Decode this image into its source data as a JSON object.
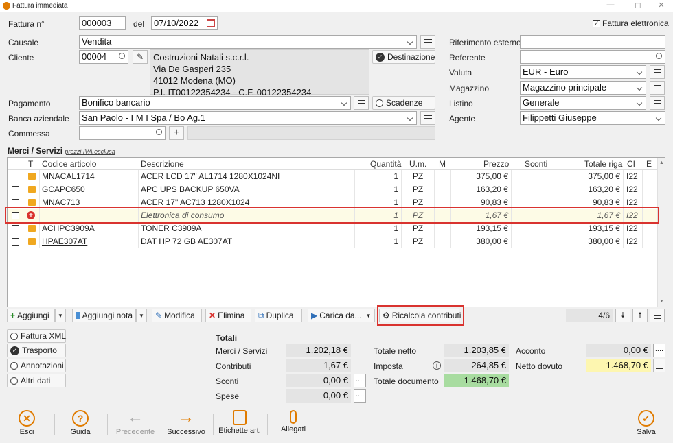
{
  "window": {
    "title": "Fattura immediata"
  },
  "header": {
    "numero_label": "Fattura n°",
    "numero": "000003",
    "del_label": "del",
    "data": "07/10/2022",
    "fattura_elettronica_label": "Fattura elettronica",
    "causale_label": "Causale",
    "causale": "Vendita",
    "cliente_label": "Cliente",
    "cliente_code": "00004",
    "address": [
      "Costruzioni Natali s.c.r.l.",
      "Via De Gasperi 235",
      "41012 Modena (MO)",
      "P.I. IT00122354234 - C.F. 00122354234"
    ],
    "destinazione_label": "Destinazione",
    "pagamento_label": "Pagamento",
    "pagamento": "Bonifico bancario",
    "scadenze_label": "Scadenze",
    "banca_label": "Banca aziendale",
    "banca": "San Paolo - I M I Spa / Bo Ag.1",
    "commessa_label": "Commessa",
    "commessa": "",
    "rif_esterno_label": "Riferimento esterno",
    "rif_esterno": "",
    "referente_label": "Referente",
    "referente": "",
    "valuta_label": "Valuta",
    "valuta": "EUR - Euro",
    "magazzino_label": "Magazzino",
    "magazzino": "Magazzino principale",
    "listino_label": "Listino",
    "listino": "Generale",
    "agente_label": "Agente",
    "agente": "Filippetti Giuseppe"
  },
  "items": {
    "title": "Merci / Servizi",
    "note": "prezzi IVA esclusa",
    "columns": {
      "t": "T",
      "codice": "Codice articolo",
      "descr": "Descrizione",
      "qta": "Quantità",
      "um": "U.m.",
      "m": "M",
      "prezzo": "Prezzo",
      "sconti": "Sconti",
      "totale": "Totale riga",
      "ci": "CI",
      "e": "E"
    },
    "rows": [
      {
        "codice": "MNACAL1714",
        "descr": "ACER LCD 17\" AL1714 1280X1024NI",
        "qta": "1",
        "um": "PZ",
        "prezzo": "375,00 €",
        "totale": "375,00 €",
        "ci": "I22"
      },
      {
        "codice": "GCAPC650",
        "descr": "APC UPS BACKUP 650VA",
        "qta": "1",
        "um": "PZ",
        "prezzo": "163,20 €",
        "totale": "163,20 €",
        "ci": "I22"
      },
      {
        "codice": "MNAC713",
        "descr": "ACER 17\" AC713 1280X1024",
        "qta": "1",
        "um": "PZ",
        "prezzo": "90,83 €",
        "totale": "90,83 €",
        "ci": "I22"
      },
      {
        "codice": "",
        "descr": "Elettronica di consumo",
        "qta": "1",
        "um": "PZ",
        "prezzo": "1,67 €",
        "totale": "1,67 €",
        "ci": "I22"
      },
      {
        "codice": "ACHPC3909A",
        "descr": "TONER C3909A",
        "qta": "1",
        "um": "PZ",
        "prezzo": "193,15 €",
        "totale": "193,15 €",
        "ci": "I22"
      },
      {
        "codice": "HPAE307AT",
        "descr": "DAT HP 72 GB AE307AT",
        "qta": "1",
        "um": "PZ",
        "prezzo": "380,00 €",
        "totale": "380,00 €",
        "ci": "I22"
      }
    ]
  },
  "toolbar": {
    "aggiungi": "Aggiungi",
    "aggiungi_nota": "Aggiungi nota",
    "modifica": "Modifica",
    "elimina": "Elimina",
    "duplica": "Duplica",
    "carica_da": "Carica da...",
    "ricalcola": "Ricalcola contributi",
    "pager": "4/6"
  },
  "side": {
    "fattura_xml": "Fattura XML",
    "trasporto": "Trasporto",
    "annotazioni": "Annotazioni",
    "altri_dati": "Altri dati"
  },
  "totals": {
    "title": "Totali",
    "merci_label": "Merci / Servizi",
    "merci": "1.202,18 €",
    "contributi_label": "Contributi",
    "contributi": "1,67 €",
    "sconti_label": "Sconti",
    "sconti": "0,00 €",
    "spese_label": "Spese",
    "spese": "0,00 €",
    "netto_label": "Totale netto",
    "netto": "1.203,85 €",
    "imposta_label": "Imposta",
    "imposta": "264,85 €",
    "documento_label": "Totale documento",
    "documento": "1.468,70 €",
    "acconto_label": "Acconto",
    "acconto": "0,00 €",
    "netto_dovuto_label": "Netto dovuto",
    "netto_dovuto": "1.468,70 €",
    "dots": "...."
  },
  "footer": {
    "esci": "Esci",
    "guida": "Guida",
    "precedente": "Precedente",
    "successivo": "Successivo",
    "etichette": "Etichette art.",
    "allegati": "Allegati",
    "salva": "Salva"
  },
  "colors": {
    "accent": "#e07b00",
    "highlight_border": "#d9332f",
    "totale_documento_bg": "#a8dca0",
    "netto_dovuto_bg": "#fdf6b0",
    "selected_row_bg": "#fdfbe6"
  }
}
